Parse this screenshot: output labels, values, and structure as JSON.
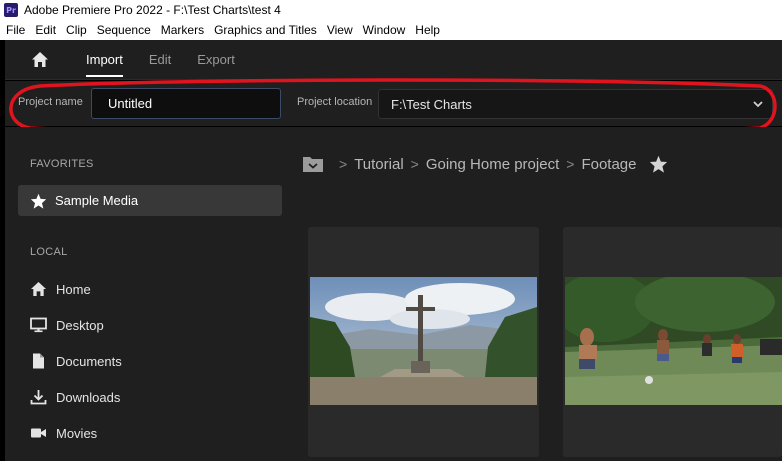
{
  "window": {
    "app_icon_text": "Pr",
    "title": "Adobe Premiere Pro 2022 - F:\\Test Charts\\test 4"
  },
  "menu": [
    "File",
    "Edit",
    "Clip",
    "Sequence",
    "Markers",
    "Graphics and Titles",
    "View",
    "Window",
    "Help"
  ],
  "header": {
    "home_icon": "home-icon",
    "tabs": [
      {
        "label": "Import",
        "active": true
      },
      {
        "label": "Edit",
        "active": false
      },
      {
        "label": "Export",
        "active": false
      }
    ]
  },
  "project": {
    "name_label": "Project name",
    "name_value": "Untitled",
    "location_label": "Project location",
    "location_value": "F:\\Test Charts"
  },
  "sidebar": {
    "favorites_label": "FAVORITES",
    "favorites": [
      {
        "label": "Sample Media",
        "icon": "star-icon"
      }
    ],
    "local_label": "LOCAL",
    "local": [
      {
        "label": "Home",
        "icon": "home-icon"
      },
      {
        "label": "Desktop",
        "icon": "monitor-icon"
      },
      {
        "label": "Documents",
        "icon": "document-icon"
      },
      {
        "label": "Downloads",
        "icon": "download-icon"
      },
      {
        "label": "Movies",
        "icon": "video-camera-icon"
      }
    ]
  },
  "breadcrumb": {
    "items": [
      "Tutorial",
      "Going Home project",
      "Footage"
    ],
    "separator": ">"
  },
  "media": [
    {
      "thumbnail": "hilltop-cross-landscape"
    },
    {
      "thumbnail": "kids-playing-soccer-field"
    }
  ],
  "colors": {
    "accent_annotation": "#e0141e",
    "background": "#1f1f1f",
    "input_border": "#3c4a66"
  }
}
